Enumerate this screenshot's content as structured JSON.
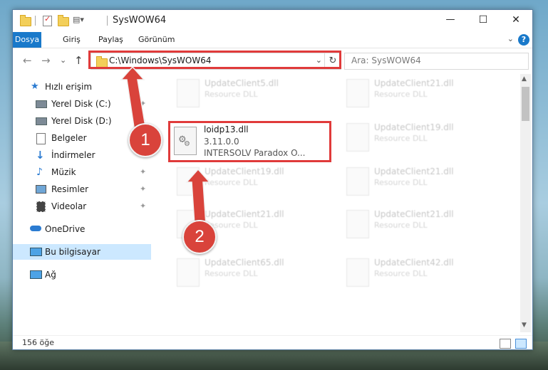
{
  "window": {
    "title": "SysWOW64",
    "minimize": "—",
    "maximize": "☐",
    "close": "✕"
  },
  "ribbon": {
    "tabs": [
      "Dosya",
      "Giriş",
      "Paylaş",
      "Görünüm"
    ],
    "help": "?",
    "expand": "⌄",
    "accent": "#1979ca"
  },
  "nav": {
    "back": "←",
    "forward": "→",
    "recent": "⌄",
    "up": "↑",
    "address": "C:\\Windows\\SysWOW64",
    "address_dropdown": "⌄",
    "refresh": "↻",
    "search_placeholder": "Ara: SysWOW64"
  },
  "sidebar": {
    "items": [
      {
        "label": "Hızlı erişim",
        "icon": "star-icon"
      },
      {
        "label": "Yerel Disk (C:)",
        "icon": "drive-icon",
        "pinned": true
      },
      {
        "label": "Yerel Disk (D:)",
        "icon": "drive-icon",
        "pinned": true
      },
      {
        "label": "Belgeler",
        "icon": "document-icon",
        "pinned": true
      },
      {
        "label": "İndirmeler",
        "icon": "download-icon",
        "pinned": true
      },
      {
        "label": "Müzik",
        "icon": "music-icon",
        "pinned": true
      },
      {
        "label": "Resimler",
        "icon": "pictures-icon",
        "pinned": true
      },
      {
        "label": "Videolar",
        "icon": "video-icon",
        "pinned": true
      },
      {
        "label": "OneDrive",
        "icon": "cloud-icon"
      },
      {
        "label": "Bu bilgisayar",
        "icon": "computer-icon",
        "selected": true
      },
      {
        "label": "Ağ",
        "icon": "network-icon"
      }
    ],
    "pin_glyph": "📌"
  },
  "files": {
    "selected": {
      "name": "loidp13.dll",
      "version": "3.11.0.0",
      "description": "INTERSOLV Paradox O..."
    },
    "blurred": [
      {
        "name": "UpdateClient5.dll",
        "type": "Resource DLL"
      },
      {
        "name": "UpdateClient21.dll",
        "type": "Resource DLL"
      },
      {
        "name": "UpdateClient19.dll",
        "type": "Resource DLL"
      },
      {
        "name": "UpdateClient19.dll",
        "type": "Resource DLL"
      },
      {
        "name": "UpdateClient21.dll",
        "type": "Resource DLL"
      },
      {
        "name": "UpdateClient21.dll",
        "type": "Resource DLL"
      },
      {
        "name": "UpdateClient21.dll",
        "type": "Resource DLL"
      },
      {
        "name": "UpdateClient65.dll",
        "type": "Resource DLL"
      },
      {
        "name": "UpdateClient42.dll",
        "type": "Resource DLL"
      }
    ]
  },
  "status": {
    "count": "156 öğe"
  },
  "annotations": {
    "badge1": "1",
    "badge2": "2",
    "highlight_color": "#e03a3a"
  }
}
